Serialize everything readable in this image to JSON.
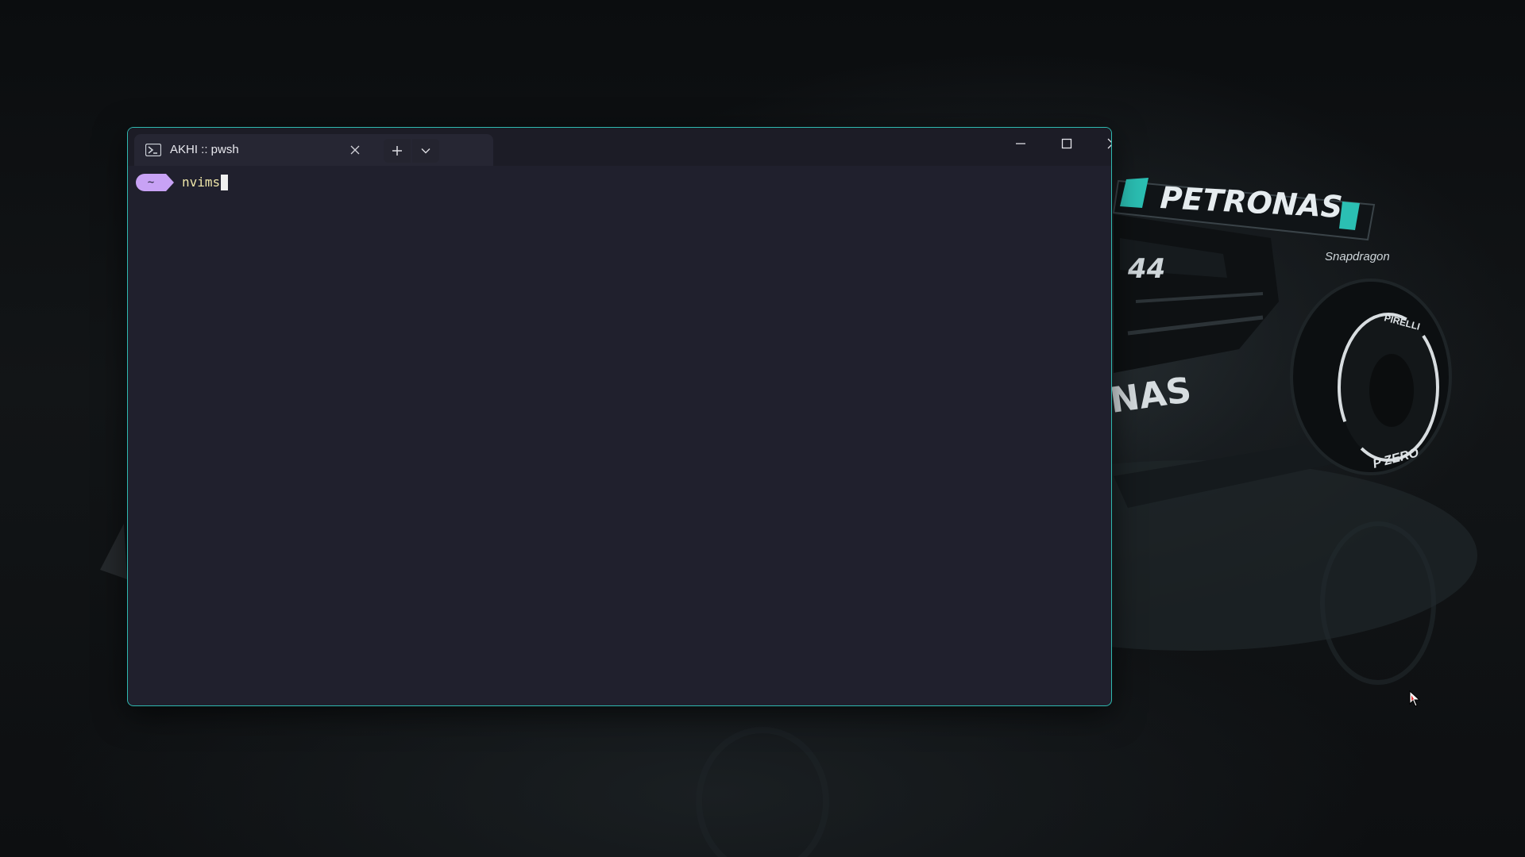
{
  "terminal": {
    "tab_title": "AKHI :: pwsh",
    "tab_icon": "powershell-icon",
    "prompt_symbol": "~",
    "command_text": "nvims",
    "accent_border": "#2fb9b0",
    "prompt_color": "#c8a2f5",
    "command_color": "#efe6a9"
  },
  "titlebar": {
    "new_tab_icon": "plus-icon",
    "dropdown_icon": "chevron-down-icon",
    "minimize_icon": "minimize-icon",
    "maximize_icon": "maximize-icon",
    "close_icon": "close-icon"
  },
  "wallpaper": {
    "wing_text": "PETRONAS",
    "car_number": "44",
    "sponsor": "Snapdragon",
    "tyre_brand": "PIRELLI",
    "tyre_text": "P ZERO",
    "sidepod_text": "NAS"
  }
}
